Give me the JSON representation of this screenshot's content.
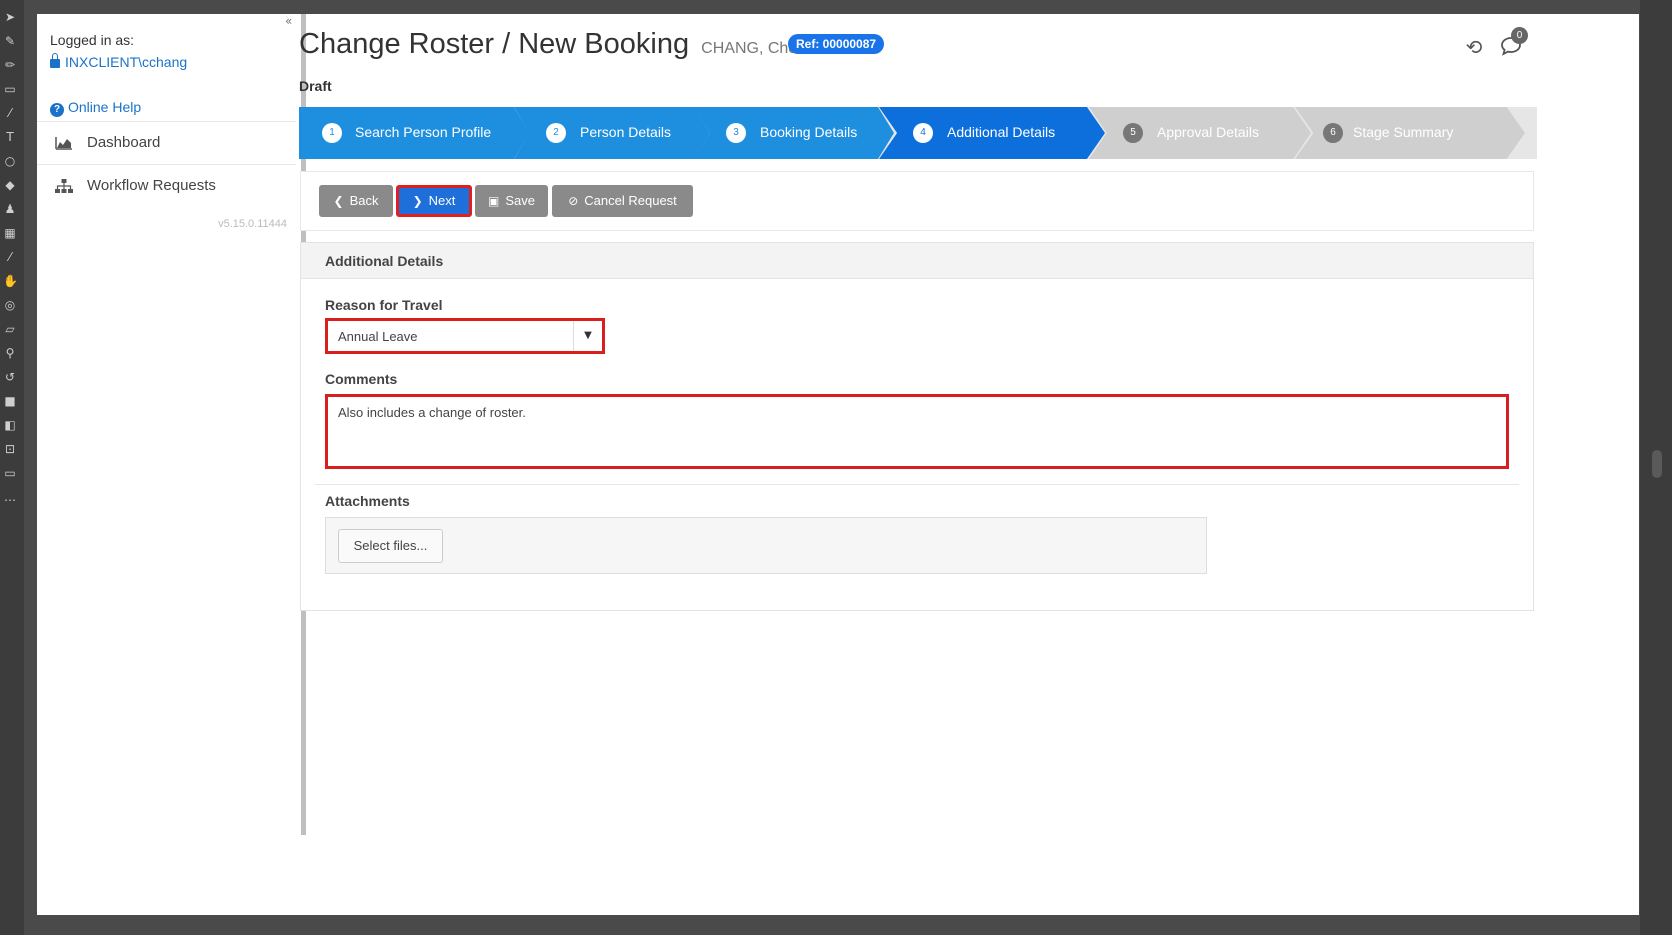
{
  "sidebar": {
    "login_label": "Logged in as:",
    "username": "INXCLIENT\\cchang",
    "help_link": "Online Help",
    "items": [
      {
        "label": "Dashboard",
        "icon": "area-chart-icon"
      },
      {
        "label": "Workflow Requests",
        "icon": "sitemap-icon"
      }
    ],
    "version": "v5.15.0.11444"
  },
  "header": {
    "title": "Change Roster / New Booking",
    "person": "CHANG, Cho",
    "ref": "Ref: 00000087",
    "status": "Draft",
    "notification_count": "0"
  },
  "steps": [
    {
      "num": "1",
      "label": "Search Person Profile",
      "state": "complete"
    },
    {
      "num": "2",
      "label": "Person Details",
      "state": "complete"
    },
    {
      "num": "3",
      "label": "Booking Details",
      "state": "complete"
    },
    {
      "num": "4",
      "label": "Additional Details",
      "state": "active"
    },
    {
      "num": "5",
      "label": "Approval Details",
      "state": "pending"
    },
    {
      "num": "6",
      "label": "Stage Summary",
      "state": "pending"
    }
  ],
  "toolbar": {
    "back": "Back",
    "next": "Next",
    "save": "Save",
    "cancel": "Cancel Request"
  },
  "panel": {
    "title": "Additional Details",
    "reason_label": "Reason for Travel",
    "reason_value": "Annual Leave",
    "comments_label": "Comments",
    "comments_value": "Also includes a change of roster.",
    "attachments_label": "Attachments",
    "select_files": "Select files..."
  },
  "colors": {
    "step_complete": "#1e8fde",
    "step_active": "#0d6fdc",
    "step_pending": "#cfcfcf",
    "highlight": "#d91e1e",
    "link": "#1a73c8"
  }
}
